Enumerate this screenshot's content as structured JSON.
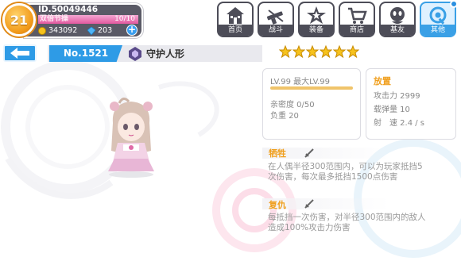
{
  "player": {
    "level": "21",
    "id": "ID.50049446",
    "exp_label": "双倍节操",
    "exp_value": "10/10",
    "exp_fraction": 1.0,
    "coins": "343092",
    "gems": "203"
  },
  "nav": [
    {
      "label": "首页",
      "icon": "home-icon"
    },
    {
      "label": "战斗",
      "icon": "battle-icon"
    },
    {
      "label": "装备",
      "icon": "equipment-icon"
    },
    {
      "label": "商店",
      "icon": "shop-icon"
    },
    {
      "label": "基友",
      "icon": "friends-icon"
    },
    {
      "label": "其他",
      "icon": "settings-icon"
    }
  ],
  "header": {
    "number": "No.1521",
    "name": "守护人形",
    "stars": 6
  },
  "stats": {
    "level_text": "LV.99 最大LV.99",
    "affection": "亲密度 0/50",
    "load": "负重 20",
    "slot": "放置",
    "attack": "攻击力 2999",
    "ammo": "载弹量 10",
    "rate": "射　速 2.4 / s"
  },
  "skills": [
    {
      "title": "牺牲",
      "desc": "在人偶半径300范围内，可以为玩家抵挡5次伤害，每次最多抵挡1500点伤害"
    },
    {
      "title": "复仇",
      "desc": "每抵挡一次伤害，对半径300范围内的敌人造成100%攻击力伤害"
    }
  ],
  "colors": {
    "accent": "#2e9be6",
    "skill_title": "#f0a020",
    "panel_dark": "#4d4d58",
    "star": "#f6c21c"
  }
}
